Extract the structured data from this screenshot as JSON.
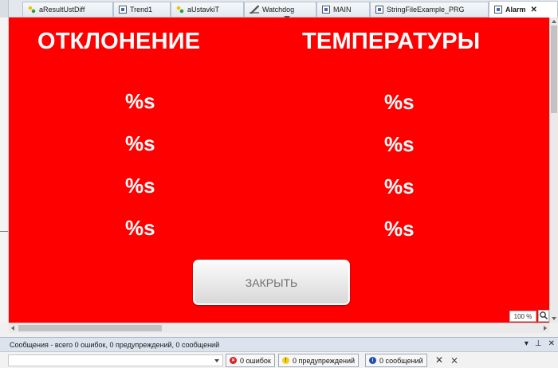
{
  "tabs": [
    {
      "label": "aResultUstDiff",
      "icon": "global-vars-icon"
    },
    {
      "label": "Trend1",
      "icon": "document-icon"
    },
    {
      "label": "aUstavkiT",
      "icon": "global-vars-icon"
    },
    {
      "label": "Watchdog",
      "icon": "watchdog-icon"
    },
    {
      "label": "MAIN",
      "icon": "document-icon"
    },
    {
      "label": "StringFileExample_PRG",
      "icon": "document-icon"
    },
    {
      "label": "Alarm",
      "icon": "document-icon",
      "active": true
    }
  ],
  "visu": {
    "background": "#ff0000",
    "heading_left": "ОТКЛОНЕНИЕ",
    "heading_right": "ТЕМПЕРАТУРЫ",
    "left_values": [
      "%s",
      "%s",
      "%s",
      "%s"
    ],
    "right_values": [
      "%s",
      "%s",
      "%s",
      "%s"
    ],
    "close_button": "ЗАКРЫТЬ"
  },
  "zoom": "100 %",
  "messages": {
    "summary": "Сообщения - всего 0 ошибок, 0 предупреждений, 0 сообщений",
    "errors": "0 ошибок",
    "warnings": "0 предупреждений",
    "infos": "0 сообщений"
  }
}
